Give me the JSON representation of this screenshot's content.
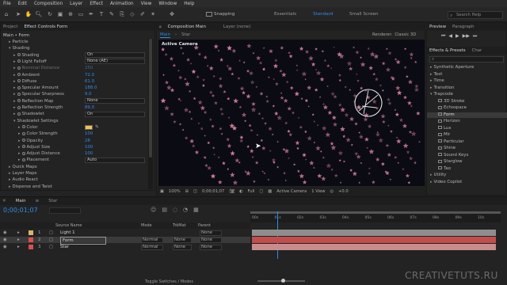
{
  "menu": [
    "File",
    "Edit",
    "Composition",
    "Layer",
    "Effect",
    "Animation",
    "View",
    "Window",
    "Help"
  ],
  "toolbar": {
    "snapping": "Snapping",
    "workspaces": [
      "Essentials",
      "Standard",
      "Small Screen"
    ],
    "active_workspace": "Standard",
    "search_placeholder": "Search Help"
  },
  "left_panel": {
    "tabs": [
      "Project",
      "Effect Controls Form"
    ],
    "breadcrumb": "Main • Form",
    "rows": [
      {
        "label": "Particle",
        "indent": 1,
        "tri": "▸"
      },
      {
        "label": "Shading",
        "indent": 1,
        "tri": "▾"
      },
      {
        "label": "Shading",
        "indent": 2,
        "dropdown": "On"
      },
      {
        "label": "Light Falloff",
        "indent": 2,
        "dropdown": "None (AE)"
      },
      {
        "label": "Nominal Distance",
        "indent": 2,
        "value": "250",
        "dim": true
      },
      {
        "label": "Ambient",
        "indent": 2,
        "value": "72.0"
      },
      {
        "label": "Diffuse",
        "indent": 2,
        "value": "61.0"
      },
      {
        "label": "Specular Amount",
        "indent": 2,
        "value": "188.0"
      },
      {
        "label": "Specular Sharpness",
        "indent": 2,
        "value": "9.0"
      },
      {
        "label": "Reflection Map",
        "indent": 2,
        "dropdown": "None"
      },
      {
        "label": "Reflection Strength",
        "indent": 2,
        "value": "89.0"
      },
      {
        "label": "Shadowlet",
        "indent": 2,
        "dropdown": "On"
      },
      {
        "label": "Shadowlet Settings",
        "indent": 2,
        "tri": "▾"
      },
      {
        "label": "Color",
        "indent": 3,
        "color": true
      },
      {
        "label": "Color Strength",
        "indent": 3,
        "value": "100"
      },
      {
        "label": "Opacity",
        "indent": 3,
        "value": "28"
      },
      {
        "label": "Adjust Size",
        "indent": 3,
        "value": "100"
      },
      {
        "label": "Adjust Distance",
        "indent": 3,
        "value": "100"
      },
      {
        "label": "Placement",
        "indent": 3,
        "dropdown": "Auto"
      },
      {
        "label": "Quick Maps",
        "indent": 1,
        "tri": "▸"
      },
      {
        "label": "Layer Maps",
        "indent": 1,
        "tri": "▸"
      },
      {
        "label": "Audio React",
        "indent": 1,
        "tri": "▸"
      },
      {
        "label": "Disperse and Twist",
        "indent": 1,
        "tri": "▸"
      }
    ]
  },
  "comp_panel": {
    "title": "Composition Main",
    "layer_tab": "Layer (none)",
    "view_tabs": [
      "Main",
      "Star"
    ],
    "renderer_label": "Renderer:",
    "renderer": "Classic 3D",
    "active_camera_label": "Active Camera",
    "footer": {
      "zoom": "100%",
      "timecode": "0;00;01;07",
      "resolution": "Full",
      "camera": "Active Camera",
      "views": "1 View",
      "offset": "+0.0"
    }
  },
  "right_panel": {
    "tabs": [
      "Preview",
      "Paragraph"
    ],
    "effects_tabs": [
      "Effects & Presets",
      "Char"
    ],
    "items": [
      {
        "label": "Synthetic Aperture",
        "tri": "▸",
        "indent": 0
      },
      {
        "label": "Text",
        "tri": "▸",
        "indent": 0
      },
      {
        "label": "Time",
        "tri": "▸",
        "indent": 0
      },
      {
        "label": "Transition",
        "tri": "▸",
        "indent": 0
      },
      {
        "label": "Trapcode",
        "tri": "▾",
        "indent": 0
      },
      {
        "label": "3D Stroke",
        "indent": 1
      },
      {
        "label": "Echospace",
        "indent": 1
      },
      {
        "label": "Form",
        "indent": 1,
        "selected": true
      },
      {
        "label": "Horizon",
        "indent": 1
      },
      {
        "label": "Lux",
        "indent": 1
      },
      {
        "label": "Mir",
        "indent": 1
      },
      {
        "label": "Particular",
        "indent": 1
      },
      {
        "label": "Shine",
        "indent": 1
      },
      {
        "label": "Sound Keys",
        "indent": 1
      },
      {
        "label": "Starglow",
        "indent": 1
      },
      {
        "label": "Tao",
        "indent": 1
      },
      {
        "label": "Utility",
        "tri": "▸",
        "indent": 0
      },
      {
        "label": "Video Copilot",
        "tri": "▸",
        "indent": 0
      }
    ]
  },
  "timeline": {
    "tabs": [
      "Main",
      "Star"
    ],
    "timecode": "0;00;01;07",
    "columns": {
      "source": "Source Name",
      "mode": "Mode",
      "trkmat": "TrkMat",
      "parent": "Parent"
    },
    "ruler": [
      "00s",
      "01s",
      "02s",
      "03s",
      "04s",
      "05s",
      "06s",
      "07s",
      "08s",
      "09s",
      "10s"
    ],
    "layers": [
      {
        "num": "1",
        "name": "Light 1",
        "mode": "",
        "parent": "None",
        "color": "#d6b66a",
        "bar": "#8e8e8e"
      },
      {
        "num": "2",
        "name": "Form",
        "mode": "Normal",
        "trkmat": "None",
        "parent": "None",
        "color": "#d94f4f",
        "bar": "#c24d4d",
        "selected": true
      },
      {
        "num": "3",
        "name": "Star",
        "mode": "Normal",
        "trkmat": "None",
        "parent": "None",
        "color": "#d94f4f",
        "bar": "#c98c8c"
      }
    ],
    "toggle": "Toggle Switches / Modes"
  },
  "watermark": "CREATIVETUTS.RU",
  "colors": {
    "accent": "#2d8ceb",
    "star": "#d8829a",
    "shadow_color": "#f2c14e"
  }
}
